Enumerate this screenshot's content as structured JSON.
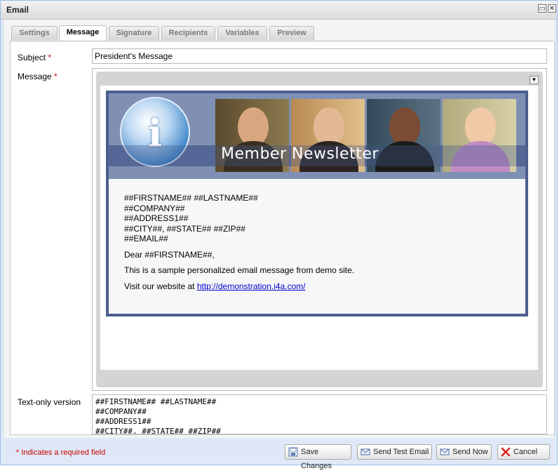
{
  "window": {
    "title": "Email",
    "restore_icon": "restore-icon",
    "close_icon": "close-icon"
  },
  "tabs": [
    {
      "label": "Settings",
      "active": false
    },
    {
      "label": "Message",
      "active": true
    },
    {
      "label": "Signature",
      "active": false
    },
    {
      "label": "Recipients",
      "active": false
    },
    {
      "label": "Variables",
      "active": false
    },
    {
      "label": "Preview",
      "active": false
    }
  ],
  "form": {
    "subject_label": "Subject",
    "required_mark": "*",
    "subject_value": "President's Message",
    "message_label": "Message",
    "textonly_label": "Text-only version"
  },
  "newsletter": {
    "banner_title": "Member Newsletter",
    "logo_letter": "i",
    "merge_lines": [
      "##FIRSTNAME## ##LASTNAME##",
      "##COMPANY##",
      "##ADDRESS1##",
      "##CITY##, ##STATE## ##ZIP##",
      "##EMAIL##"
    ],
    "greeting": "Dear ##FIRSTNAME##,",
    "sample_text": "This is a sample personalized email message from demo site.",
    "visit_text": "Visit our website at ",
    "link_text": "http://demonstration.i4a.com/"
  },
  "textonly": {
    "lines": [
      "##FIRSTNAME## ##LASTNAME##",
      "##COMPANY##",
      "##ADDRESS1##",
      "##CITY##, ##STATE## ##ZIP##"
    ]
  },
  "footer": {
    "required_note": "* Indicates a required field",
    "save_label": "Save Changes",
    "test_label": "Send Test Email",
    "send_label": "Send Now",
    "cancel_label": "Cancel"
  },
  "colors": {
    "accent": "#99bbe8",
    "required": "#cc0000",
    "newsletter_border": "#4b5f8c",
    "link": "#0000cc"
  }
}
